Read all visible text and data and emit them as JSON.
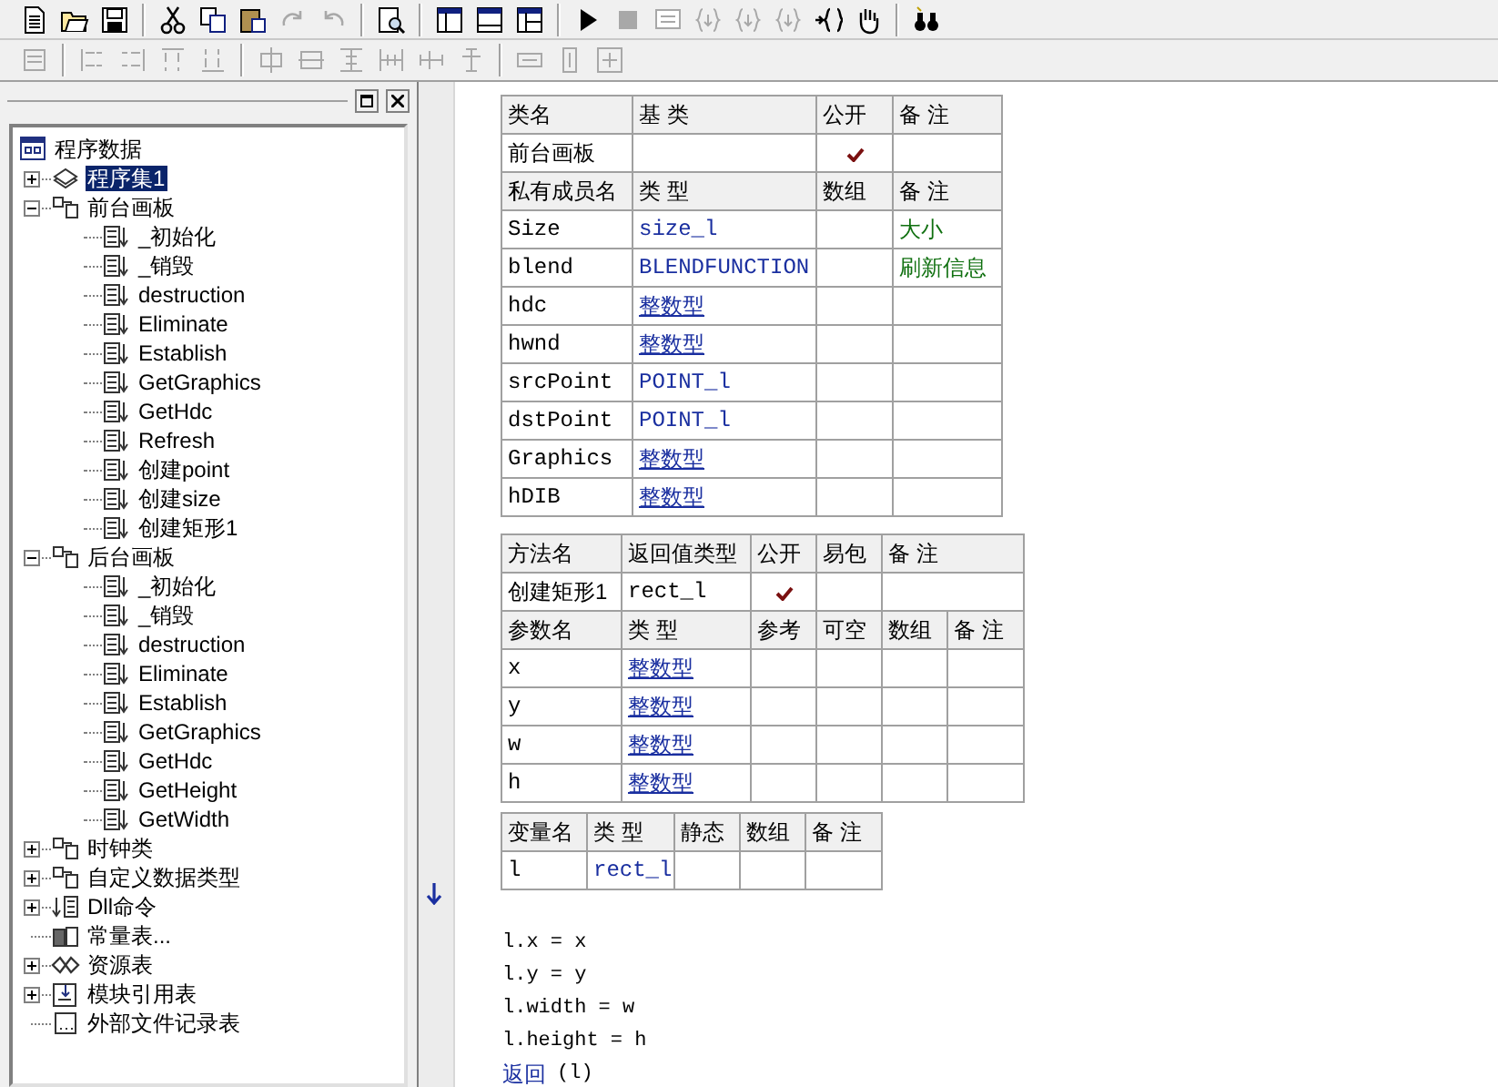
{
  "toolbar": [
    {
      "groups": [
        [
          {
            "disabled": false
          },
          {
            "disabled": false
          },
          {
            "disabled": false
          }
        ],
        [
          {
            "disabled": false
          },
          {
            "disabled": false
          },
          {
            "disabled": false
          },
          {
            "disabled": true
          },
          {
            "disabled": true
          }
        ],
        [
          {
            "disabled": false
          }
        ],
        [
          {
            "disabled": false
          },
          {
            "disabled": false
          },
          {
            "disabled": false
          }
        ],
        [
          {
            "disabled": false
          },
          {
            "disabled": true
          },
          {
            "disabled": true
          },
          {
            "disabled": true
          },
          {
            "disabled": true
          },
          {
            "disabled": true
          },
          {
            "disabled": false
          },
          {
            "disabled": false
          }
        ],
        [
          {
            "disabled": false
          }
        ]
      ]
    },
    {
      "groups": [
        [
          {
            "disabled": true
          }
        ],
        [
          {
            "disabled": true
          },
          {
            "disabled": true
          },
          {
            "disabled": true
          },
          {
            "disabled": true
          }
        ],
        [
          {
            "disabled": true
          },
          {
            "disabled": true
          },
          {
            "disabled": true
          },
          {
            "disabled": true
          },
          {
            "disabled": true
          },
          {
            "disabled": true
          }
        ],
        [
          {
            "disabled": true
          },
          {
            "disabled": true
          },
          {
            "disabled": true
          }
        ]
      ]
    }
  ],
  "tree": {
    "label": "程序数据",
    "kind": "project",
    "selected": false,
    "children": [
      {
        "label": "程序集1",
        "kind": "set",
        "expanded": false,
        "selected": true
      },
      {
        "label": "前台画板",
        "kind": "class",
        "expanded": true,
        "selected": false,
        "children": [
          {
            "label": "_初始化",
            "kind": "method",
            "selected": false
          },
          {
            "label": "_销毁",
            "kind": "method",
            "selected": false
          },
          {
            "label": "destruction",
            "kind": "method",
            "selected": false
          },
          {
            "label": "Eliminate",
            "kind": "method",
            "selected": false
          },
          {
            "label": "Establish",
            "kind": "method",
            "selected": false
          },
          {
            "label": "GetGraphics",
            "kind": "method",
            "selected": false
          },
          {
            "label": "GetHdc",
            "kind": "method",
            "selected": false
          },
          {
            "label": "Refresh",
            "kind": "method",
            "selected": false
          },
          {
            "label": "创建point",
            "kind": "method",
            "selected": false
          },
          {
            "label": "创建size",
            "kind": "method",
            "selected": false
          },
          {
            "label": "创建矩形1",
            "kind": "method",
            "selected": false
          }
        ]
      },
      {
        "label": "后台画板",
        "kind": "class",
        "expanded": true,
        "selected": false,
        "children": [
          {
            "label": "_初始化",
            "kind": "method",
            "selected": false
          },
          {
            "label": "_销毁",
            "kind": "method",
            "selected": false
          },
          {
            "label": "destruction",
            "kind": "method",
            "selected": false
          },
          {
            "label": "Eliminate",
            "kind": "method",
            "selected": false
          },
          {
            "label": "Establish",
            "kind": "method",
            "selected": false
          },
          {
            "label": "GetGraphics",
            "kind": "method",
            "selected": false
          },
          {
            "label": "GetHdc",
            "kind": "method",
            "selected": false
          },
          {
            "label": "GetHeight",
            "kind": "method",
            "selected": false
          },
          {
            "label": "GetWidth",
            "kind": "method",
            "selected": false
          }
        ]
      },
      {
        "label": "时钟类",
        "kind": "class",
        "expanded": false,
        "selected": false
      },
      {
        "label": "自定义数据类型",
        "kind": "class",
        "expanded": false,
        "selected": false
      },
      {
        "label": "Dll命令",
        "kind": "dll",
        "expanded": false,
        "selected": false
      },
      {
        "label": "常量表...",
        "kind": "constants",
        "selected": false
      },
      {
        "label": "资源表",
        "kind": "resources",
        "expanded": false,
        "selected": false
      },
      {
        "label": "模块引用表",
        "kind": "modules",
        "expanded": false,
        "selected": false
      },
      {
        "label": "外部文件记录表",
        "kind": "files",
        "selected": false
      }
    ]
  },
  "class_table": {
    "header": [
      "类名",
      "基 类",
      "公开",
      "备 注"
    ],
    "class": {
      "name": "前台画板",
      "public": true
    },
    "member_header": [
      "私有成员名",
      "类 型",
      "数组",
      "备 注"
    ],
    "members": [
      {
        "name": "Size",
        "type": "size_l",
        "link": false,
        "note": "大小"
      },
      {
        "name": "blend",
        "type": "BLENDFUNCTION",
        "link": false,
        "note": "刷新信息"
      },
      {
        "name": "hdc",
        "type": "整数型",
        "link": true
      },
      {
        "name": "hwnd",
        "type": "整数型",
        "link": true
      },
      {
        "name": "srcPoint",
        "type": "POINT_l",
        "link": false
      },
      {
        "name": "dstPoint",
        "type": "POINT_l",
        "link": false
      },
      {
        "name": "Graphics",
        "type": "整数型",
        "link": true
      },
      {
        "name": "hDIB",
        "type": "整数型",
        "link": true
      }
    ]
  },
  "method_table": {
    "header": [
      "方法名",
      "返回值类型",
      "公开",
      "易包",
      "备 注"
    ],
    "method": {
      "name": "创建矩形1",
      "return_type": "rect_l",
      "public": true,
      "easy_package": false
    },
    "param_header": [
      "参数名",
      "类 型",
      "参考",
      "可空",
      "数组",
      "备 注"
    ],
    "params": [
      {
        "name": "x",
        "type": "整数型",
        "link": true
      },
      {
        "name": "y",
        "type": "整数型",
        "link": true
      },
      {
        "name": "w",
        "type": "整数型",
        "link": true
      },
      {
        "name": "h",
        "type": "整数型",
        "link": true
      }
    ]
  },
  "local_table": {
    "header": [
      "变量名",
      "类 型",
      "静态",
      "数组",
      "备 注"
    ],
    "rows": [
      {
        "name": "l",
        "type": "rect_l",
        "link": false
      }
    ]
  },
  "code_lines": [
    {
      "text": "l.x = x"
    },
    {
      "text": "l.y = y"
    },
    {
      "text": "l.width = w"
    },
    {
      "text": "l.height = h"
    },
    {
      "keyword": "返回",
      "text": "(l)"
    }
  ]
}
